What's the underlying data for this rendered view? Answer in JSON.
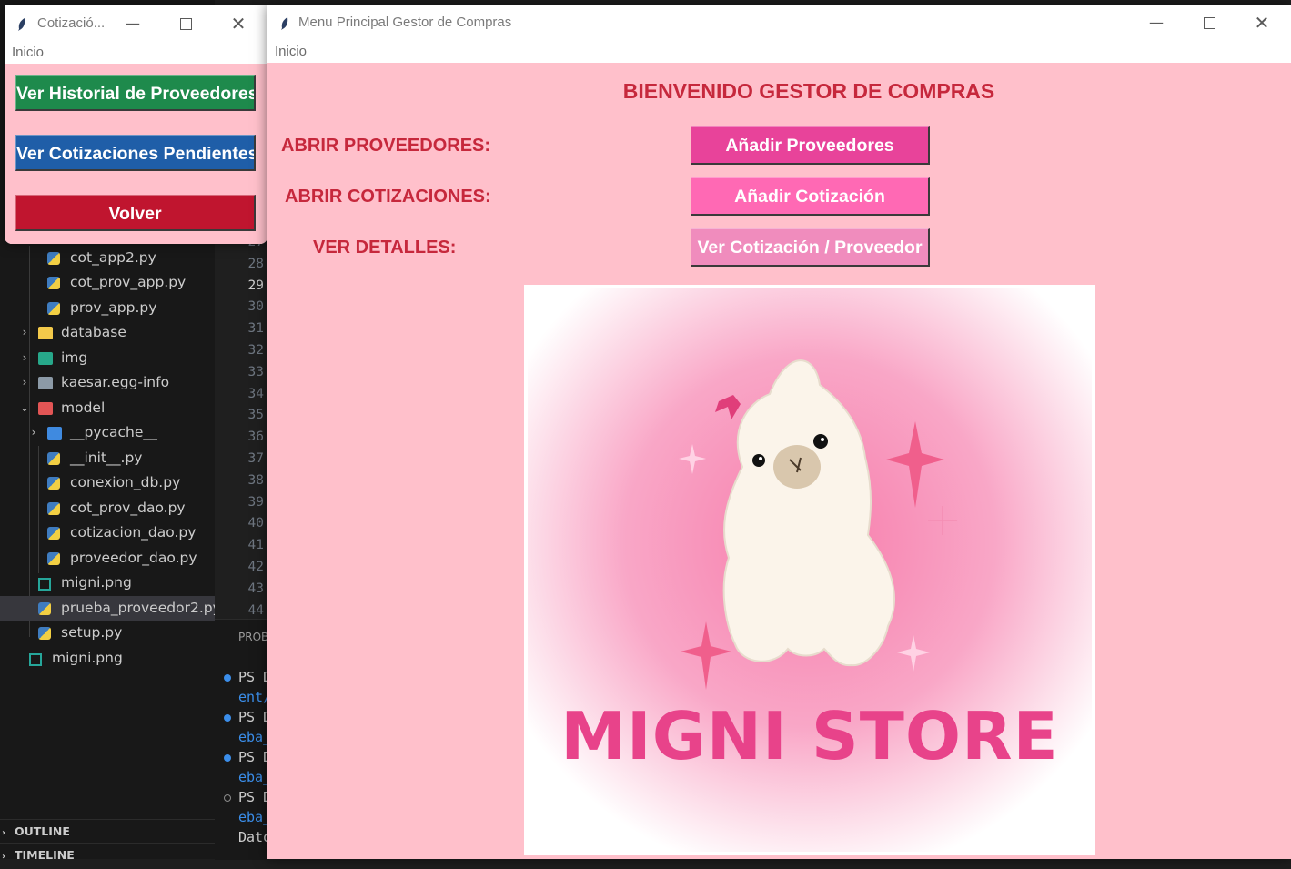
{
  "vscode": {
    "explorer": {
      "items": [
        {
          "label": "cot_app2.py",
          "type": "python"
        },
        {
          "label": "cot_prov_app.py",
          "type": "python"
        },
        {
          "label": "prov_app.py",
          "type": "python"
        },
        {
          "label": "database",
          "type": "folder",
          "chevron": "›"
        },
        {
          "label": "img",
          "type": "folder",
          "chevron": "›"
        },
        {
          "label": "kaesar.egg-info",
          "type": "folder",
          "chevron": "›"
        },
        {
          "label": "model",
          "type": "folder",
          "chevron": "⌄"
        },
        {
          "label": "__pycache__",
          "type": "folder",
          "chevron": "›"
        },
        {
          "label": "__init__.py",
          "type": "python"
        },
        {
          "label": "conexion_db.py",
          "type": "python"
        },
        {
          "label": "cot_prov_dao.py",
          "type": "python"
        },
        {
          "label": "cotizacion_dao.py",
          "type": "python"
        },
        {
          "label": "proveedor_dao.py",
          "type": "python"
        },
        {
          "label": "migni.png",
          "type": "image"
        },
        {
          "label": "prueba_proveedor2.py",
          "type": "python",
          "selected": true
        },
        {
          "label": "setup.py",
          "type": "python"
        },
        {
          "label": "migni.png",
          "type": "image"
        }
      ],
      "panels": [
        "OUTLINE",
        "TIMELINE"
      ]
    },
    "line_numbers": [
      "27",
      "28",
      "29",
      "30",
      "31",
      "32",
      "33",
      "34",
      "35",
      "36",
      "37",
      "38",
      "39",
      "40",
      "41",
      "42",
      "43",
      "44"
    ],
    "current_line": "29",
    "terminal": {
      "tab_label": "PROB",
      "lines": [
        "PS D",
        "ent/",
        "PS D",
        "eba_",
        "PS D",
        "eba_",
        "PS D",
        "eba_",
        "Dato"
      ]
    }
  },
  "cotizacion_window": {
    "title": "Cotizació...",
    "menu": "Inicio",
    "buttons": [
      {
        "label": "Ver Historial de Proveedores",
        "color": "#1e8a4c"
      },
      {
        "label": "Ver Cotizaciones Pendientes",
        "color": "#1f5ea8"
      },
      {
        "label": "Volver",
        "color": "#c0152f"
      }
    ]
  },
  "main_window": {
    "title": "Menu Principal Gestor de Compras",
    "menu": "Inicio",
    "heading": "BIENVENIDO GESTOR DE COMPRAS",
    "rows": [
      {
        "label": "ABRIR PROVEEDORES:",
        "button": "Añadir Proveedores",
        "color": "#e8439a"
      },
      {
        "label": "ABRIR COTIZACIONES:",
        "button": "Añadir Cotización",
        "color": "#ff69b4"
      },
      {
        "label": "VER DETALLES:",
        "button": "Ver Cotización / Proveedor",
        "color": "#f08cbd"
      }
    ],
    "logo_text": "MIGNI STORE"
  },
  "colors": {
    "window_bg": "#ffc0cb",
    "label_red": "#c6283c",
    "logo_pink": "#e8438a"
  }
}
